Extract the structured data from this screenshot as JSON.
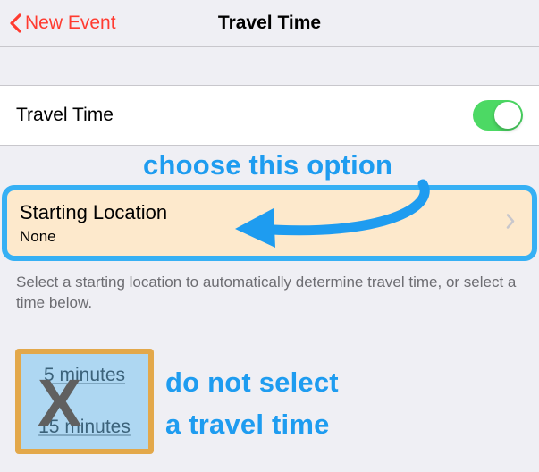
{
  "header": {
    "back_label": "New Event",
    "title": "Travel Time"
  },
  "toggle_row": {
    "label": "Travel Time",
    "enabled": true
  },
  "annotations": {
    "choose": "choose this option",
    "dont_line1": "do not select",
    "dont_line2": "a travel time",
    "x_mark": "X"
  },
  "starting_location": {
    "label": "Starting Location",
    "value": "None"
  },
  "help_text": "Select a starting location to automatically determine travel time, or select a time below.",
  "time_options": {
    "opt1": "5 minutes",
    "opt2": "15 minutes"
  }
}
